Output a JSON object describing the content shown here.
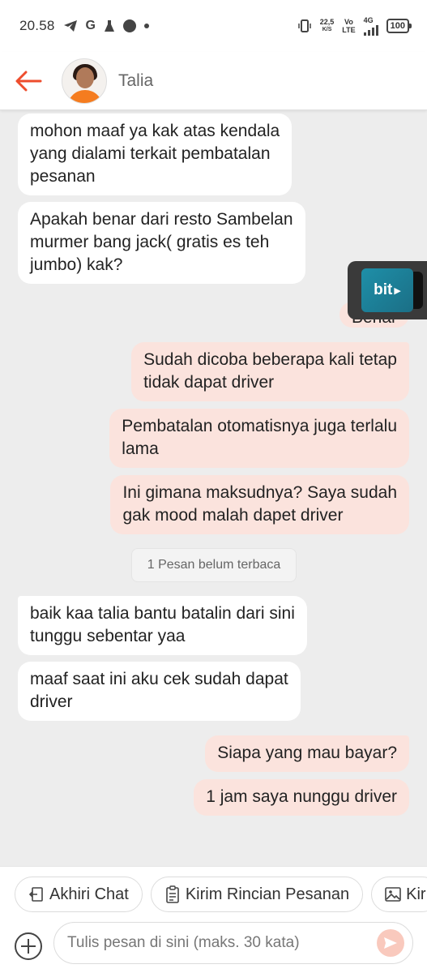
{
  "status_bar": {
    "time": "20.58",
    "speed_value": "22,5",
    "speed_unit": "K/S",
    "vo_label": "Vo",
    "lte_label": "LTE",
    "network": "4G",
    "battery": "100"
  },
  "header": {
    "contact_name": "Talia",
    "accent_color": "#ee4d2d"
  },
  "messages": [
    {
      "side": "in",
      "text": "mohon maaf ya kak atas kendala\nyang dialami terkait pembatalan\npesanan"
    },
    {
      "side": "in",
      "text": "Apakah benar dari resto Sambelan\nmurmer bang jack( gratis es teh\njumbo) kak?"
    },
    {
      "side": "out",
      "text": "Benar"
    },
    {
      "side": "out",
      "text": "Sudah dicoba beberapa kali tetap\ntidak dapat driver"
    },
    {
      "side": "out",
      "text": "Pembatalan otomatisnya juga terlalu\nlama"
    },
    {
      "side": "out",
      "text": "Ini gimana maksudnya? Saya sudah\ngak mood malah dapet driver"
    },
    {
      "side": "in",
      "text": "baik kaa talia bantu batalin dari sini\ntunggu sebentar yaa"
    },
    {
      "side": "in",
      "text": "maaf saat ini aku cek sudah dapat\ndriver"
    },
    {
      "side": "out",
      "text": "Siapa yang mau bayar?"
    },
    {
      "side": "out",
      "text": "1 jam saya nunggu driver"
    }
  ],
  "unread_divider": "1 Pesan belum terbaca",
  "floating_widget": {
    "label": "bit"
  },
  "quick_actions": [
    {
      "label": "Akhiri Chat",
      "icon": "exit-icon"
    },
    {
      "label": "Kirim Rincian Pesanan",
      "icon": "clipboard-icon"
    },
    {
      "label": "Kir",
      "icon": "image-icon"
    }
  ],
  "composer": {
    "placeholder": "Tulis pesan di sini (maks. 30 kata)"
  }
}
